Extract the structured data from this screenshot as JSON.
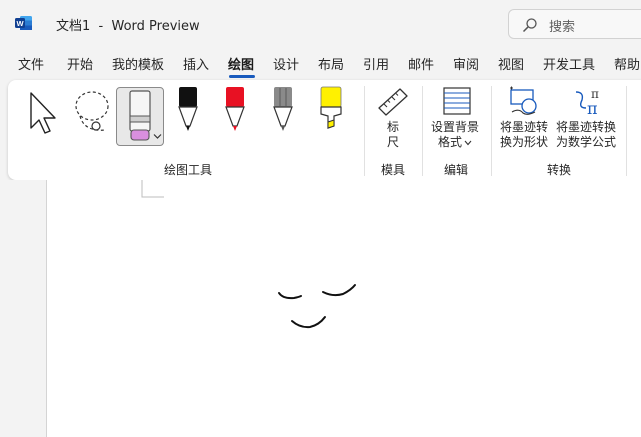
{
  "app": {
    "doc_name": "文档1",
    "separator": "-",
    "app_name": "Word Preview"
  },
  "search": {
    "placeholder": "搜索"
  },
  "tabs": [
    {
      "label": "文件"
    },
    {
      "label": "开始"
    },
    {
      "label": "我的模板"
    },
    {
      "label": "插入"
    },
    {
      "label": "绘图",
      "active": true
    },
    {
      "label": "设计"
    },
    {
      "label": "布局"
    },
    {
      "label": "引用"
    },
    {
      "label": "邮件"
    },
    {
      "label": "审阅"
    },
    {
      "label": "视图"
    },
    {
      "label": "开发工具"
    },
    {
      "label": "帮助"
    }
  ],
  "ribbon": {
    "drawing_tools": {
      "group_label": "绘图工具",
      "tools": [
        {
          "name": "select",
          "icon": "arrow-cursor-icon"
        },
        {
          "name": "lasso",
          "icon": "lasso-select-icon"
        },
        {
          "name": "eraser",
          "icon": "eraser-icon",
          "selected": true
        },
        {
          "name": "pen-black",
          "icon": "pen-icon",
          "color": "#111111"
        },
        {
          "name": "pen-red",
          "icon": "pen-icon",
          "color": "#e81123"
        },
        {
          "name": "pencil-gray",
          "icon": "pencil-icon",
          "color": "#7a7a7a"
        },
        {
          "name": "highlighter-yellow",
          "icon": "highlighter-icon",
          "color": "#fff100"
        }
      ]
    },
    "stencils": {
      "group_label": "模具",
      "ruler_label_line1": "标",
      "ruler_label_line2": "尺"
    },
    "edit": {
      "group_label": "编辑",
      "bg_label_line1": "设置背景",
      "bg_label_line2": "格式"
    },
    "convert": {
      "group_label": "转换",
      "to_shape_line1": "将墨迹转",
      "to_shape_line2": "换为形状",
      "to_math_line1": "将墨迹转换",
      "to_math_line2": "为数学公式"
    }
  },
  "colors": {
    "accent": "#185abd",
    "word_brand": "#185abd"
  }
}
